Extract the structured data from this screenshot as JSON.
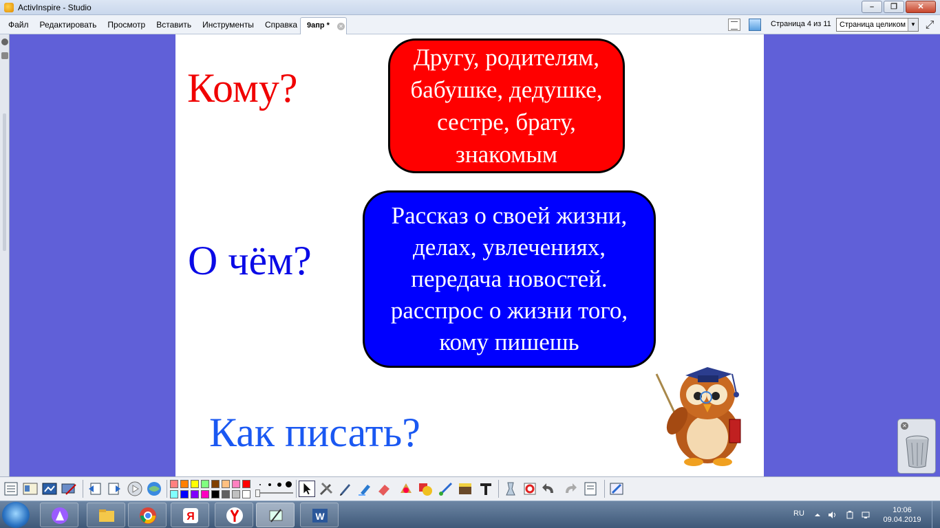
{
  "window": {
    "title": "ActivInspire - Studio"
  },
  "menu": {
    "items": [
      "Файл",
      "Редактировать",
      "Просмотр",
      "Вставить",
      "Инструменты",
      "Справка"
    ]
  },
  "document_tab": {
    "label": "9апр *"
  },
  "page_nav": {
    "page_info": "Страница 4 из 11",
    "zoom_value": "Страница целиком"
  },
  "slide": {
    "q1": "Кому?",
    "q2": "О чём?",
    "q3": "Как писать?",
    "box1": "Другу, родителям,\nбабушке, дедушке,\nсестре, брату,\nзнакомым",
    "box2": "Рассказ о своей жизни,\nделах, увлечениях,\nпередача новостей.\nрасспрос о жизни того,\nкому пишешь"
  },
  "colors": {
    "q1": "#f00000",
    "q2": "#0a0ae6",
    "q3": "#1a58f2",
    "box1_bg": "#ff0000",
    "box2_bg": "#0000ff",
    "desktop_bg": "#6060d8"
  },
  "palette": [
    "#ff8080",
    "#ff8000",
    "#ffff00",
    "#80ff80",
    "#804000",
    "#ffc080",
    "#ff80c0",
    "#ff0000",
    "#80ffff",
    "#0000ff",
    "#8000ff",
    "#ff00c0",
    "#000000",
    "#606060",
    "#c0c0c0",
    "#ffffff"
  ],
  "taskbar": {
    "apps": [
      "start-orb",
      "alice-icon",
      "file-explorer-icon",
      "chrome-icon",
      "yandex-icon",
      "yandex-browser-icon",
      "activinspire-icon",
      "word-icon"
    ],
    "language": "RU",
    "time": "10:06",
    "date": "09.04.2019"
  }
}
